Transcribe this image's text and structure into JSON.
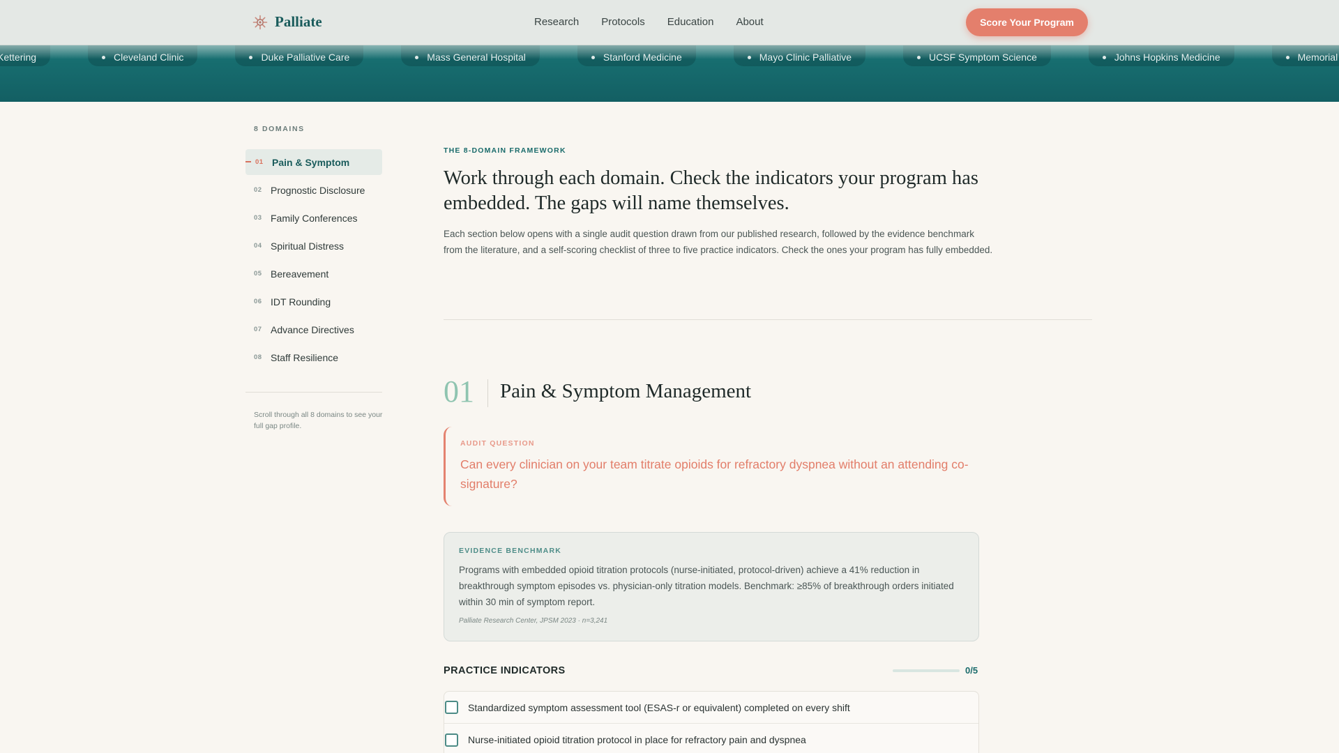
{
  "header": {
    "brand": "Palliate",
    "logo_icon": "sunburst-icon",
    "nav": [
      "Research",
      "Protocols",
      "Education",
      "About"
    ],
    "cta_label": "Score Your Program"
  },
  "partners": [
    "Kettering",
    "Cleveland Clinic",
    "Duke Palliative Care",
    "Mass General Hospital",
    "Stanford Medicine",
    "Mayo Clinic Palliative",
    "UCSF Symptom Science",
    "Johns Hopkins Medicine",
    "Memorial"
  ],
  "sidebar": {
    "title": "8 DOMAINS",
    "items": [
      {
        "num": "01",
        "label": "Pain & Symptom",
        "active": true
      },
      {
        "num": "02",
        "label": "Prognostic Disclosure"
      },
      {
        "num": "03",
        "label": "Family Conferences"
      },
      {
        "num": "04",
        "label": "Spiritual Distress"
      },
      {
        "num": "05",
        "label": "Bereavement"
      },
      {
        "num": "06",
        "label": "IDT Rounding"
      },
      {
        "num": "07",
        "label": "Advance Directives"
      },
      {
        "num": "08",
        "label": "Staff Resilience"
      }
    ],
    "note": "Scroll through all 8 domains to see your full gap profile."
  },
  "main": {
    "eyebrow": "THE 8-DOMAIN FRAMEWORK",
    "headline": "Work through each domain. Check the indicators your program has embedded. The gaps will name themselves.",
    "intro": "Each section below opens with a single audit question drawn from our published research, followed by the evidence benchmark from the literature, and a self-scoring checklist of three to five practice indicators. Check the ones your program has fully embedded.",
    "section": {
      "num": "01",
      "title": "Pain & Symptom Management",
      "audit_label": "AUDIT QUESTION",
      "audit_question": "Can every clinician on your team titrate opioids for refractory dyspnea without an attending co-signature?",
      "evidence_label": "EVIDENCE BENCHMARK",
      "evidence_text": "Programs with embedded opioid titration protocols (nurse-initiated, protocol-driven) achieve a 41% reduction in breakthrough symptom episodes vs. physician-only titration models. Benchmark: ≥85% of breakthrough orders initiated within 30 min of symptom report.",
      "evidence_cite": "Palliate Research Center, JPSM 2023 · n=3,241",
      "indicators_title": "PRACTICE INDICATORS",
      "indicators_count": "0/5",
      "indicators_progress": 0,
      "indicators": [
        "Standardized symptom assessment tool (ESAS-r or equivalent) completed on every shift",
        "Nurse-initiated opioid titration protocol in place for refractory pain and dyspnea"
      ]
    }
  },
  "colors": {
    "brand": "#1a5c5c",
    "accent": "#e47f6c",
    "band": "#176e70",
    "background": "#f9f6f1"
  }
}
